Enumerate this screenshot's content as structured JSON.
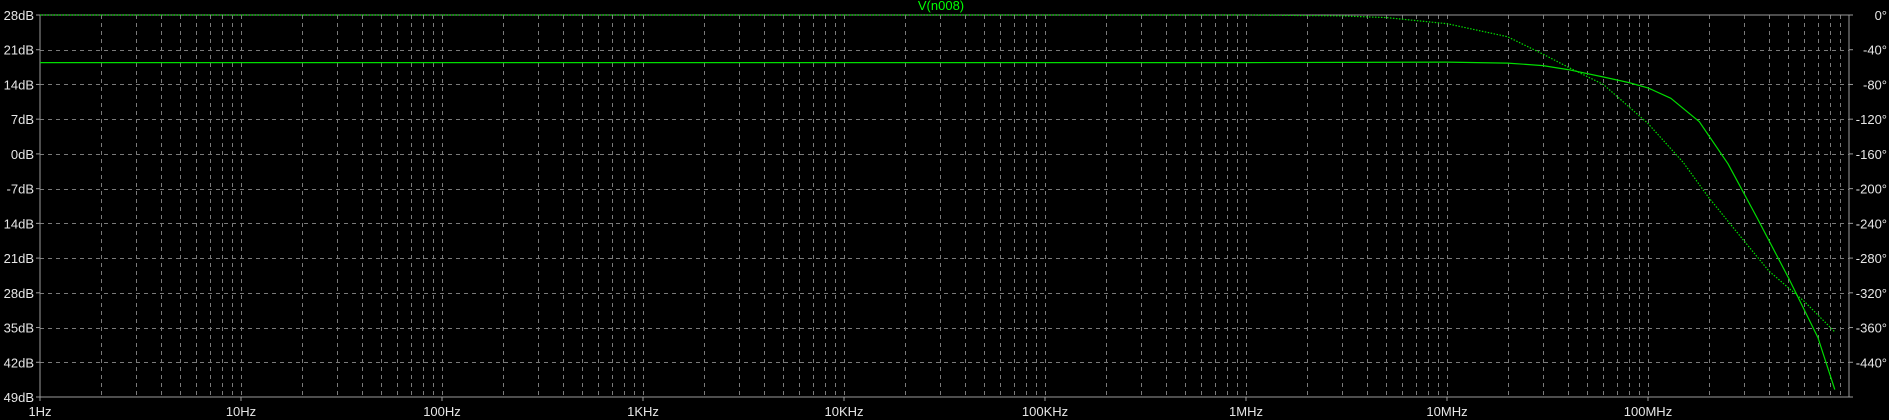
{
  "chart_data": {
    "type": "line",
    "title": "V(n008)",
    "x_scale": "log",
    "xlim_hz": [
      1,
      1000000000
    ],
    "x_tick_values": [
      1,
      10,
      100,
      1000,
      10000,
      100000,
      1000000,
      10000000,
      100000000
    ],
    "x_tick_labels": [
      "1Hz",
      "10Hz",
      "100Hz",
      "1KHz",
      "10KHz",
      "100KHz",
      "1MHz",
      "10MHz",
      "100MHz"
    ],
    "y_left": {
      "label": "",
      "unit": "dB",
      "range": [
        -49,
        28
      ],
      "tick_values": [
        28,
        21,
        14,
        7,
        0,
        -7,
        -14,
        -21,
        -28,
        -35,
        -42,
        -49
      ],
      "tick_labels": [
        "28dB",
        "21dB",
        "14dB",
        "7dB",
        "0dB",
        "-7dB",
        "14dB",
        "21dB",
        "28dB",
        "35dB",
        "42dB",
        "49dB"
      ]
    },
    "y_right": {
      "label": "",
      "unit": "degrees",
      "range": [
        -440,
        0
      ],
      "tick_values": [
        0,
        -40,
        -80,
        -120,
        -160,
        -200,
        -240,
        -280,
        -320,
        -360,
        -400,
        -440
      ],
      "tick_labels": [
        "0°",
        "-40°",
        "-80°",
        "-120°",
        "-160°",
        "-200°",
        "-240°",
        "-280°",
        "-320°",
        "-360°",
        "-440°"
      ]
    },
    "grid": true,
    "series": [
      {
        "name": "V(n008)",
        "quantity": "magnitude",
        "axis": "left",
        "style": "solid",
        "color": "#00dd00",
        "points": [
          [
            1,
            18.4
          ],
          [
            1000,
            18.4
          ],
          [
            1000000,
            18.4
          ],
          [
            3000000,
            18.45
          ],
          [
            10000000,
            18.5
          ],
          [
            20000000,
            18.3
          ],
          [
            30000000,
            17.8
          ],
          [
            40000000,
            17.0
          ],
          [
            60000000,
            15.5
          ],
          [
            80000000,
            14.4
          ],
          [
            100000000,
            13.3
          ],
          [
            130000000,
            11.2
          ],
          [
            180000000,
            6.5
          ],
          [
            250000000,
            -2.0
          ],
          [
            350000000,
            -13.0
          ],
          [
            500000000,
            -25.0
          ],
          [
            700000000,
            -37.0
          ],
          [
            850000000,
            -47.5
          ]
        ]
      },
      {
        "name": "V(n008) phase",
        "quantity": "phase",
        "axis": "right",
        "style": "dotted",
        "color": "#00dd00",
        "points": [
          [
            1,
            0
          ],
          [
            1000000,
            0
          ],
          [
            3000000,
            -1
          ],
          [
            5000000,
            -3
          ],
          [
            10000000,
            -10
          ],
          [
            20000000,
            -25
          ],
          [
            30000000,
            -45
          ],
          [
            40000000,
            -60
          ],
          [
            60000000,
            -80
          ],
          [
            100000000,
            -125
          ],
          [
            150000000,
            -170
          ],
          [
            200000000,
            -210
          ],
          [
            300000000,
            -260
          ],
          [
            400000000,
            -295
          ],
          [
            600000000,
            -330
          ],
          [
            850000000,
            -365
          ]
        ]
      }
    ]
  }
}
